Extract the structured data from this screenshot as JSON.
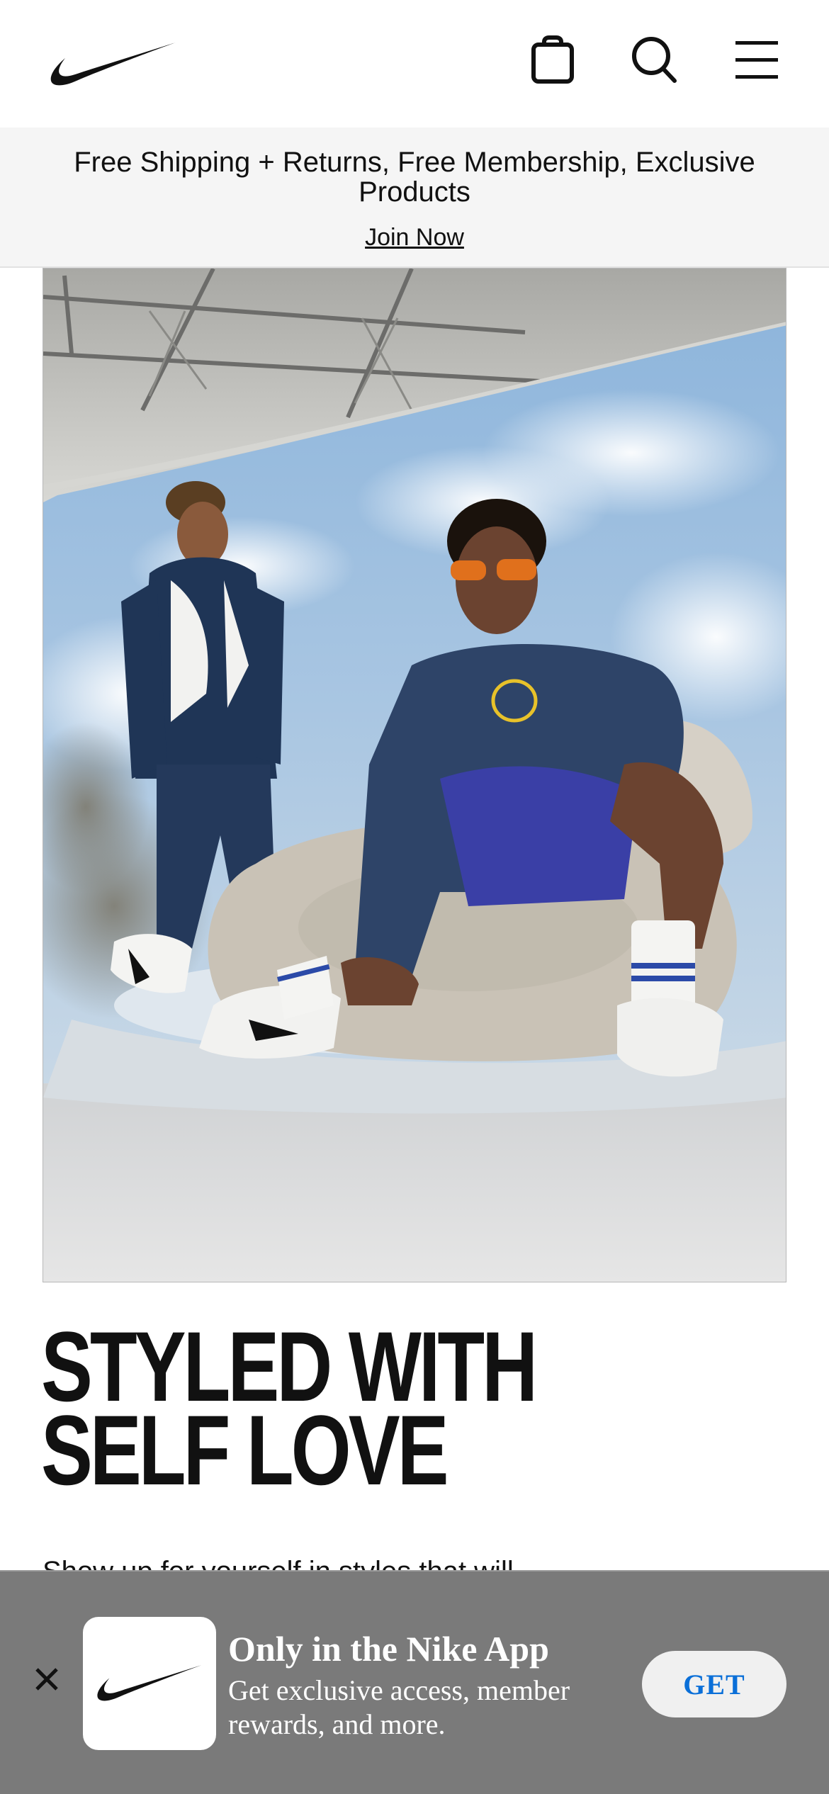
{
  "header": {
    "logo": "nike-swoosh-logo",
    "icons": [
      "bag-icon",
      "search-icon",
      "menu-icon"
    ]
  },
  "promo": {
    "text": "Free Shipping + Returns, Free Membership, Exclusive Products",
    "link": "Join Now"
  },
  "hero": {
    "image": "two-models-studio-sky-backdrop-photo"
  },
  "main": {
    "headline_line1": "STYLED WITH",
    "headline_line2": "SELF LOVE",
    "body_partial": "Show up for yourself in styles that will..."
  },
  "app_banner": {
    "title": "Only in the Nike App",
    "subtitle": "Get exclusive access, member rewards, and more.",
    "button": "GET",
    "close_icon": "close-icon"
  },
  "colors": {
    "banner_bg": "#7a7a7a",
    "get_text": "#0a6fd8",
    "promo_bg": "#f5f5f5"
  }
}
